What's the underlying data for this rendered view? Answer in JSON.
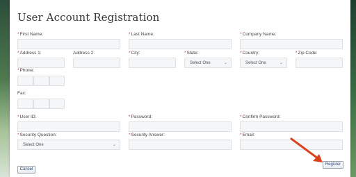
{
  "form": {
    "title": "User Account Registration",
    "required_mark": "*",
    "first_name_label": "First Name:",
    "last_name_label": "Last Name:",
    "company_name_label": "Company Name:",
    "address1_label": "Address 1:",
    "address2_label": "Address 2:",
    "city_label": "City:",
    "state_label": "State:",
    "state_value": "Select One",
    "country_label": "Country:",
    "country_value": "Select One",
    "zip_label": "Zip Code:",
    "phone_label": "Phone:",
    "fax_label": "Fax:",
    "user_id_label": "User ID:",
    "password_label": "Password:",
    "confirm_password_label": "Confirm Password:",
    "security_question_label": "Security Question:",
    "security_question_value": "Select One",
    "security_answer_label": "Security Answer:",
    "email_label": "Email:",
    "register_label": "Register",
    "cancel_label": "Cancel"
  },
  "icons": {
    "dropdown": "chevron-down-icon",
    "annotation": "red-arrow-icon"
  },
  "colors": {
    "required": "#c0392b",
    "field_bg": "#f4f6f8",
    "button_text": "#2b4a7a",
    "arrow": "#d9441e"
  }
}
